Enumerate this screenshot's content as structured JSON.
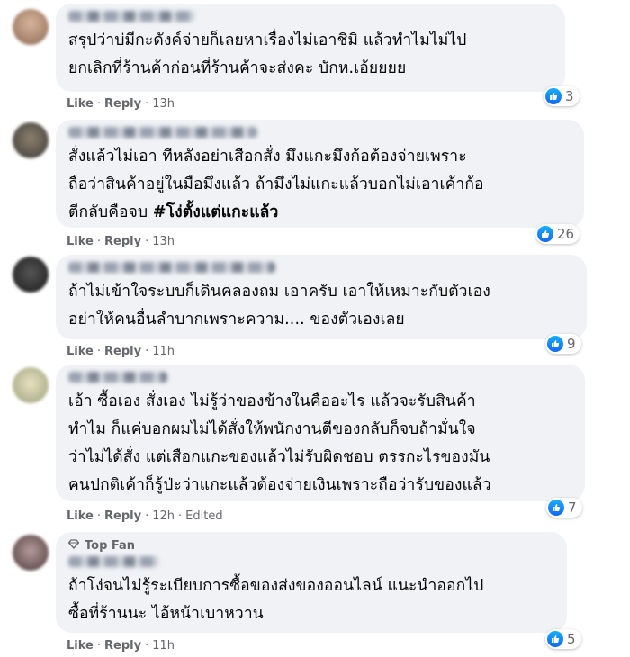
{
  "comments": [
    {
      "lines": [
        "สรุปว่าบ่มีกะดังค์จ่ายก็เลยหาเรื่องไม่เอาชิมิ แล้วทำไมไม่ไป",
        "ยกเลิกที่ร้านค้าก่อนที่ร้านค้าจะส่งคะ บักห.เอ้ยยยย"
      ],
      "like_label": "Like",
      "reply_label": "Reply",
      "time": "13h",
      "reaction_icon": "like-icon",
      "reaction_count": "3"
    },
    {
      "lines": [
        "สั่งแล้วไม่เอา ทีหลังอย่าเสือกสั่ง มึงแกะมึงก้อต้องจ่ายเพราะ",
        "ถือว่าสินค้าอยู่ในมือมึงแล้ว ถ้ามึงไม่แกะแล้วบอกไม่เอาเค้าก้อ",
        "ตีกลับคือจบ "
      ],
      "hashtag": "#โง่ตั้งแต่แกะแล้ว",
      "like_label": "Like",
      "reply_label": "Reply",
      "time": "13h",
      "reaction_icon": "like-icon",
      "reaction_count": "26"
    },
    {
      "lines": [
        "ถ้าไม่เข้าใจระบบก็เดินคลองถม เอาครับ เอาให้เหมาะกับตัวเอง",
        "อย่าให้คนอื่นลำบากเพราะความ.... ของตัวเองเลย"
      ],
      "like_label": "Like",
      "reply_label": "Reply",
      "time": "11h",
      "reaction_icon": "like-icon",
      "reaction_count": "9"
    },
    {
      "lines": [
        "เอ้า ซื้อเอง สั่งเอง ไม่รู้ว่าของข้างในคืออะไร แล้วจะรับสินค้า",
        "ทำไม ก็แค่บอกผมไม่ได้สั่งให้พนักงานตีของกลับก็จบถ้ามั่นใจ",
        "ว่าไม่ได้สั่ง แต่เสือกแกะของแล้วไม่รับผิดชอบ ตรรกะไรของมัน",
        "คนปกติเค้าก็รู้ป่ะว่าแกะแล้วต้องจ่ายเงินเพราะถือว่ารับของแล้ว"
      ],
      "like_label": "Like",
      "reply_label": "Reply",
      "time": "12h",
      "edited": "Edited",
      "reaction_icon": "like-icon",
      "reaction_count": "7"
    },
    {
      "badge": "Top Fan",
      "lines": [
        "ถ้าโง่จนไม่รู้ระเบียบการซื้อของส่งของออนไลน์ แนะนำออกไป",
        "ซื้อที่ร้านนะ ไอ้หน้าเบาหวาน"
      ],
      "like_label": "Like",
      "reply_label": "Reply",
      "time": "11h",
      "reaction_icon": "like-icon",
      "reaction_count": "5"
    }
  ],
  "colors": {
    "bubble": "#f0f2f5",
    "meta": "#65676b",
    "like_blue": "#1877f2"
  }
}
